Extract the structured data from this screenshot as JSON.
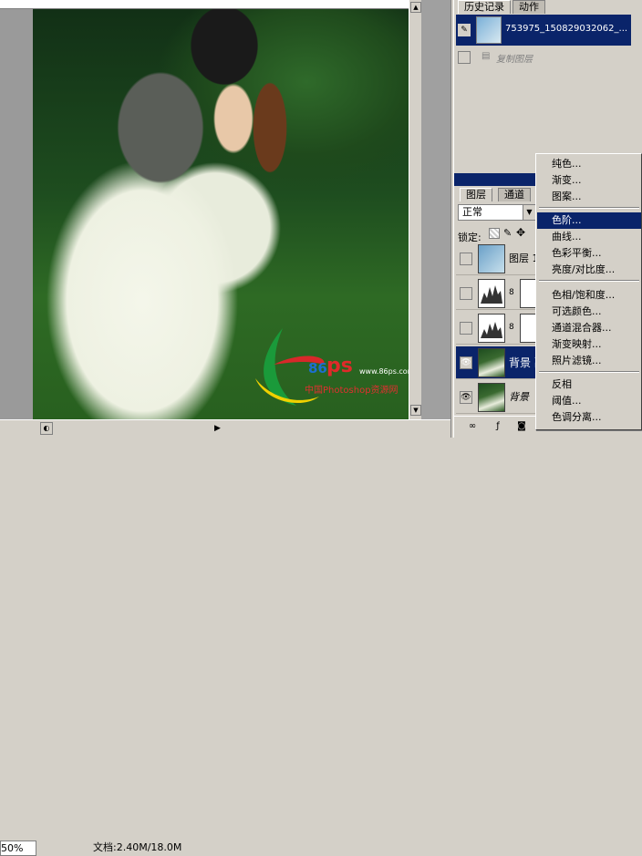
{
  "canvas": {
    "zoom": "50%",
    "doc_info": "文档:2.40M/18.0M",
    "watermark": {
      "site_number": "86",
      "site_letters": "ps",
      "url": "www.86ps.com",
      "caption": "中国Photoshop资源网"
    }
  },
  "history_panel": {
    "tabs": [
      "历史记录",
      "动作"
    ],
    "snapshot_name": "753975_150829032062_...",
    "step": "复制图层"
  },
  "layers_panel": {
    "tabs": [
      "图层",
      "通道"
    ],
    "blend_mode": "正常",
    "lock_label": "锁定:",
    "layers": [
      {
        "name": "图层 1",
        "selected": false
      },
      {
        "name": "",
        "selected": false
      },
      {
        "name": "",
        "selected": false
      },
      {
        "name": "背景 副",
        "selected": true
      },
      {
        "name": "背景",
        "selected": false
      }
    ]
  },
  "context_menu": {
    "items": [
      "纯色...",
      "渐变...",
      "图案...",
      "色阶...",
      "曲线...",
      "色彩平衡...",
      "亮度/对比度...",
      "色相/饱和度...",
      "可选颜色...",
      "通道混合器...",
      "渐变映射...",
      "照片滤镜...",
      "反相",
      "阈值...",
      "色调分离..."
    ],
    "highlighted": "色阶..."
  },
  "colors": {
    "selection": "#0a246a",
    "panel_bg": "#d4d0c8",
    "watermark_red": "#d8282a",
    "watermark_green": "#1a9a3a",
    "watermark_yellow": "#f0d000"
  }
}
